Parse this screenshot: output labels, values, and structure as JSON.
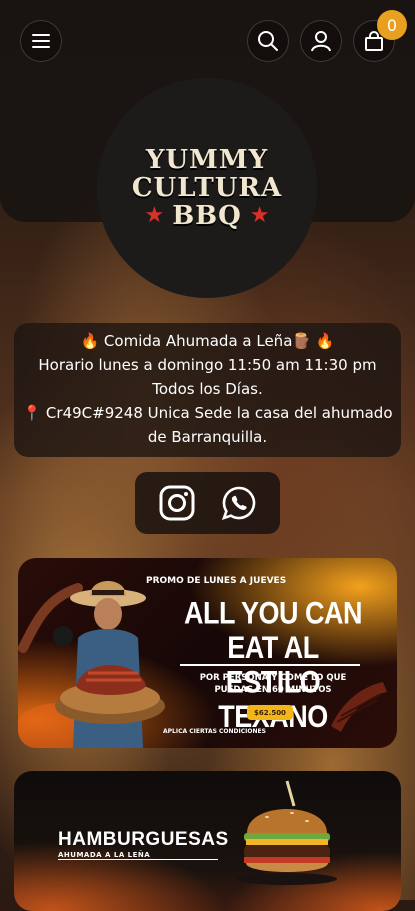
{
  "header": {
    "cart_count": "0"
  },
  "logo": {
    "line1": "YUMMY",
    "line2": "CULTURA",
    "line3": "BBQ"
  },
  "info": {
    "line1": "🔥 Comida Ahumada a Leña🪵 🔥",
    "line2": "Horario lunes a domingo 11:50 am 11:30 pm",
    "line3": "Todos los Días.",
    "line4": "📍 Cr49C#9248 Unica Sede la casa del ahumado",
    "line5": "de Barranquilla."
  },
  "social": {
    "icons": [
      "instagram-icon",
      "whatsapp-icon"
    ]
  },
  "promo": {
    "tagline": "PROMO DE LUNES A JUEVES",
    "title_line1": "ALL YOU CAN EAT AL",
    "title_line2": "ESTILO TEXANO",
    "subtitle_line1": "POR PERSONA Y COME LO QUE",
    "subtitle_line2": "PUEDAS EN 60 MINUTOS",
    "price": "$62.500",
    "conditions": "APLICA CIERTAS CONDICIONES"
  },
  "category": {
    "title": "HAMBURGUESAS",
    "subtitle": "AHUMADA A LA LEÑA"
  },
  "colors": {
    "badge": "#e7a020",
    "star": "#d8302a",
    "price_tag": "#f2b619"
  }
}
